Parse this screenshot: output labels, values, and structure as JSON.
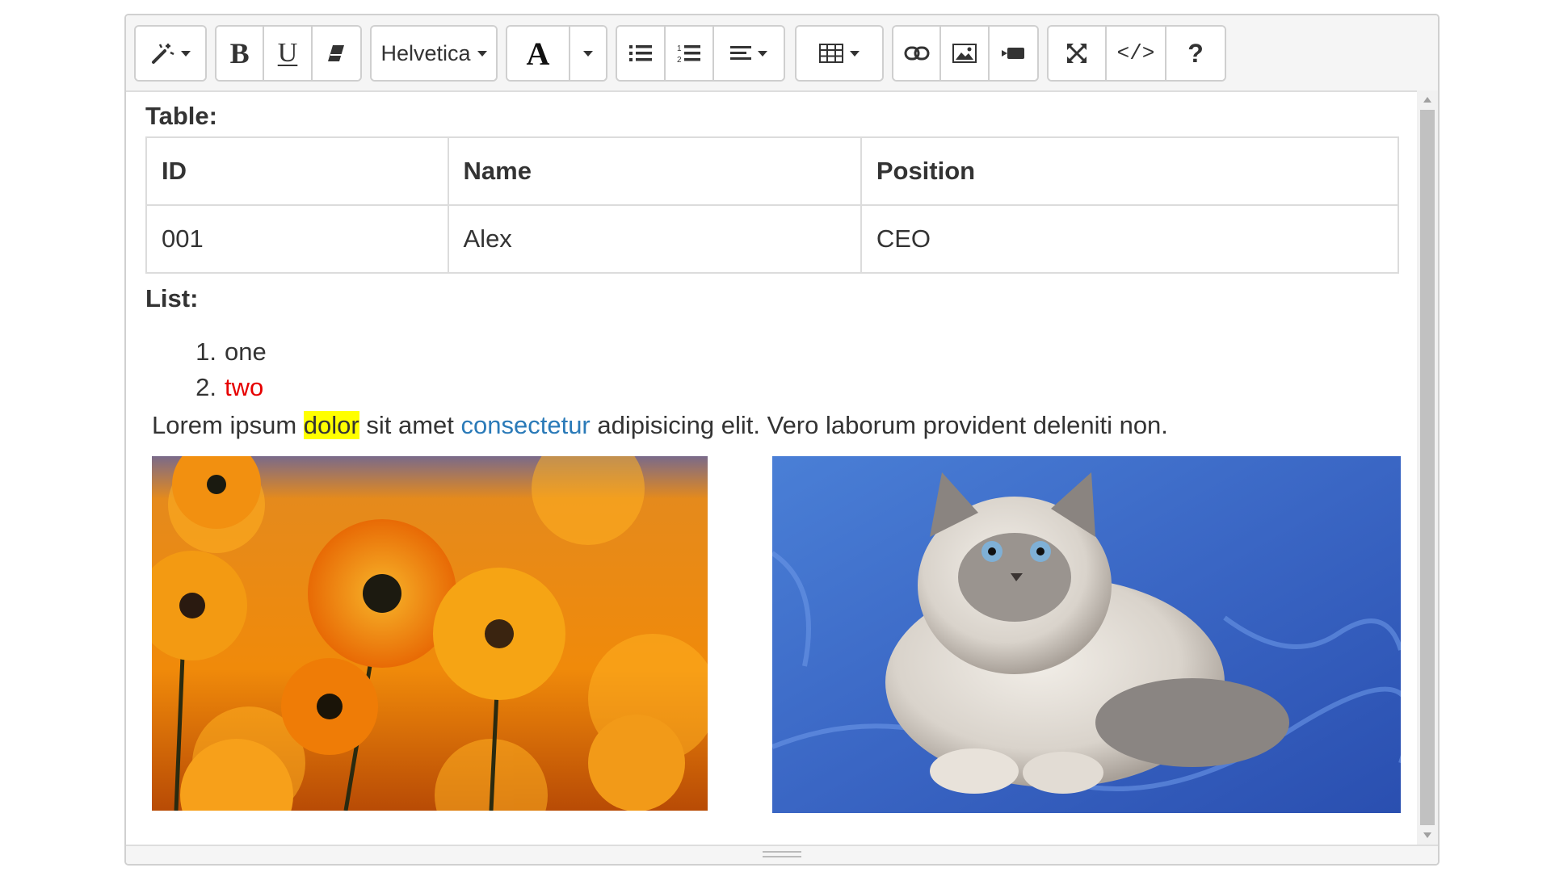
{
  "toolbar": {
    "style_icon": "magic-wand-icon",
    "bold_label": "B",
    "underline_label": "U",
    "eraser_icon": "eraser-icon",
    "font_name": "Helvetica",
    "color_label": "A",
    "ul_icon": "unordered-list-icon",
    "ol_icon": "ordered-list-icon",
    "align_icon": "align-icon",
    "table_icon": "table-icon",
    "link_icon": "link-icon",
    "picture_icon": "picture-icon",
    "video_icon": "video-icon",
    "fullscreen_icon": "fullscreen-icon",
    "code_label": "</>",
    "help_label": "?"
  },
  "content": {
    "table_heading": "Table:",
    "table": {
      "headers": [
        "ID",
        "Name",
        "Position"
      ],
      "rows": [
        [
          "001",
          "Alex",
          "CEO"
        ]
      ]
    },
    "list_heading": "List:",
    "list": [
      {
        "num": "1.",
        "text": "one"
      },
      {
        "num": "2.",
        "text": "two"
      }
    ],
    "paragraph": {
      "before": "Lorem ipsum ",
      "highlight": "dolor",
      "middle": " sit amet ",
      "link": "consectetur",
      "after": " adipisicing elit. Vero laborum provident deleniti non."
    },
    "images": [
      "orange-flowers-image",
      "persian-cat-image"
    ]
  },
  "colors": {
    "highlight": "#ffff00",
    "link": "#2a7ab8",
    "list_red": "#e60000"
  }
}
